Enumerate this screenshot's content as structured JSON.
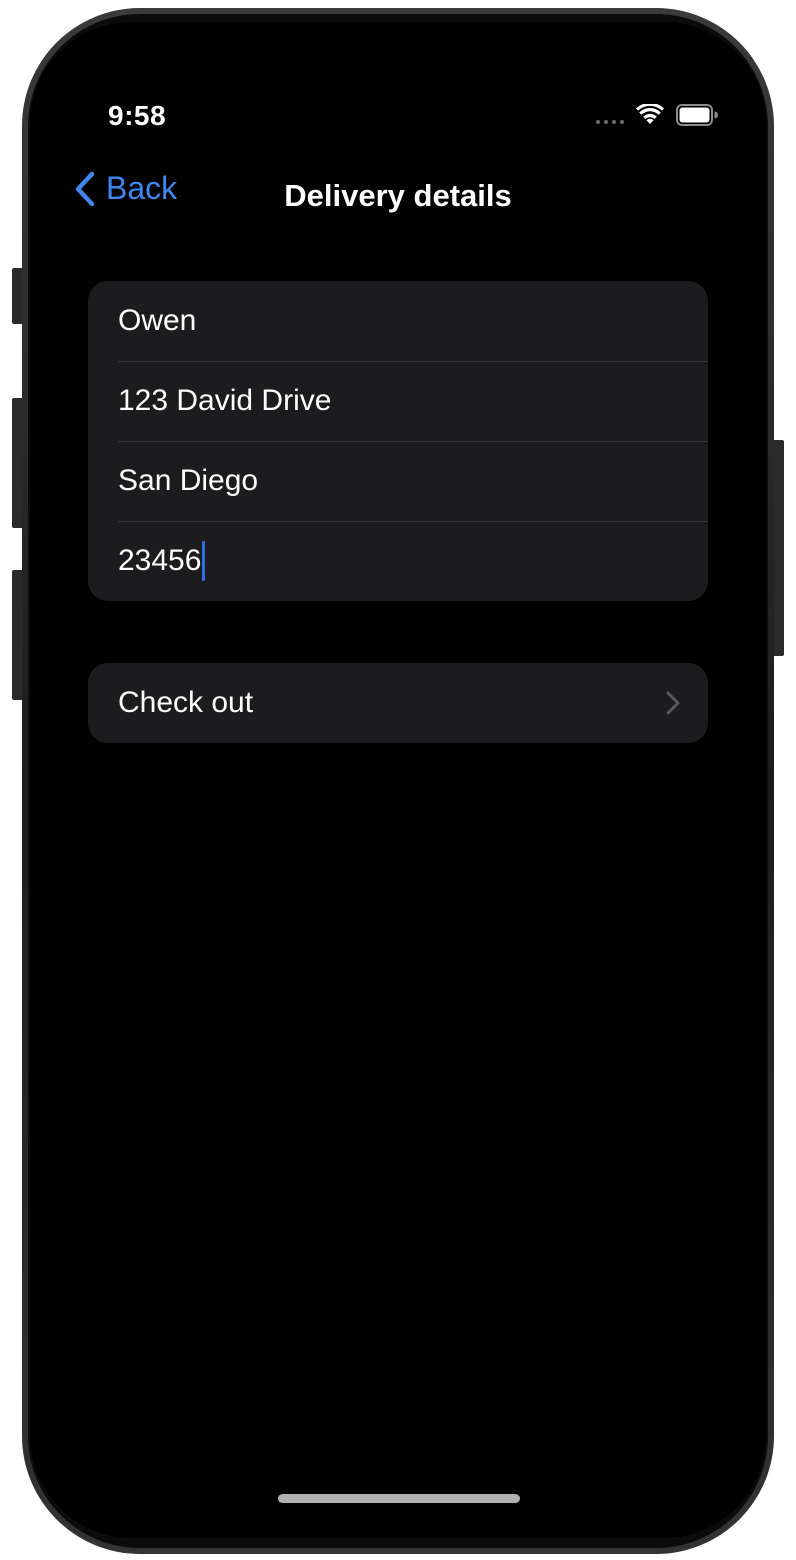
{
  "status_bar": {
    "time": "9:58",
    "icons": [
      "signal-dots-icon",
      "wifi-icon",
      "battery-icon"
    ]
  },
  "nav": {
    "back_label": "Back",
    "title": "Delivery details"
  },
  "form": {
    "name": "Owen",
    "street": "123 David Drive",
    "city": "San Diego",
    "zip": "23456"
  },
  "actions": {
    "checkout_label": "Check out"
  },
  "colors": {
    "accent": "#3e86f0",
    "background": "#000000",
    "cell": "#1c1c1e",
    "separator": "#38383a",
    "text": "#ffffff"
  }
}
